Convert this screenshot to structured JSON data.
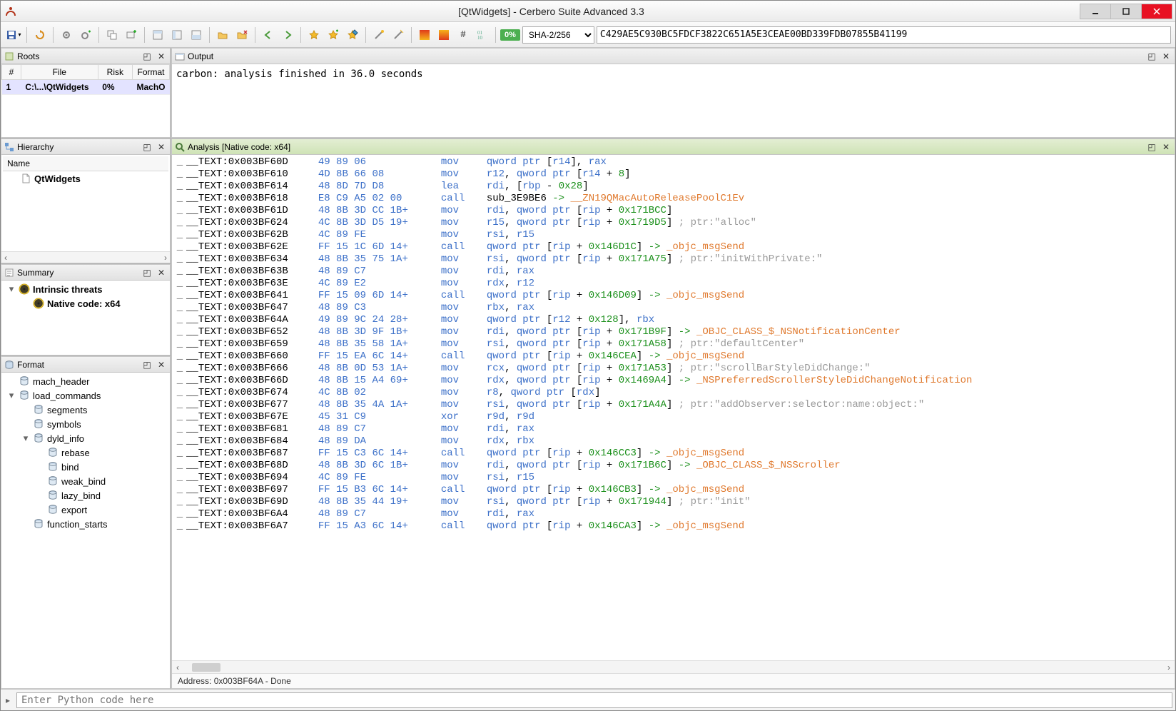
{
  "window": {
    "title": "[QtWidgets] - Cerbero Suite Advanced 3.3"
  },
  "toolbar": {
    "pct": "0%",
    "hash_algo": "SHA-2/256",
    "hash_value": "C429AE5C930BC5FDCF3822C651A5E3CEAE00BD339FDB07855B41199"
  },
  "roots": {
    "title": "Roots",
    "cols": [
      "#",
      "File",
      "Risk",
      "Format"
    ],
    "rows": [
      {
        "n": "1",
        "file": "C:\\...\\QtWidgets",
        "risk": "0%",
        "format": "MachO"
      }
    ]
  },
  "output": {
    "title": "Output",
    "text": "carbon: analysis finished in 36.0 seconds"
  },
  "hierarchy": {
    "title": "Hierarchy",
    "header": "Name",
    "items": [
      {
        "label": "QtWidgets",
        "icon": "file"
      }
    ]
  },
  "summary": {
    "title": "Summary",
    "items": [
      {
        "label": "Intrinsic threats",
        "icon": "nuke",
        "expand": true,
        "bold": true,
        "indent": 0
      },
      {
        "label": "Native code: x64",
        "icon": "nuke",
        "bold": true,
        "indent": 1
      }
    ]
  },
  "format": {
    "title": "Format",
    "items": [
      {
        "label": "mach_header",
        "icon": "db",
        "indent": 0
      },
      {
        "label": "load_commands",
        "icon": "db",
        "indent": 0,
        "expand": true
      },
      {
        "label": "segments",
        "icon": "db",
        "indent": 1
      },
      {
        "label": "symbols",
        "icon": "db",
        "indent": 1
      },
      {
        "label": "dyld_info",
        "icon": "db",
        "indent": 1,
        "expand": true
      },
      {
        "label": "rebase",
        "icon": "db",
        "indent": 2
      },
      {
        "label": "bind",
        "icon": "db",
        "indent": 2
      },
      {
        "label": "weak_bind",
        "icon": "db",
        "indent": 2
      },
      {
        "label": "lazy_bind",
        "icon": "db",
        "indent": 2
      },
      {
        "label": "export",
        "icon": "db",
        "indent": 2
      },
      {
        "label": "function_starts",
        "icon": "db",
        "indent": 1
      }
    ]
  },
  "analysis": {
    "title": "Analysis [Native code: x64]",
    "status": "Address: 0x003BF64A - Done",
    "lines": [
      {
        "a": "__TEXT:0x003BF60D",
        "h": "49 89 06",
        "m": "mov",
        "ops": [
          [
            "kw",
            "qword ptr "
          ],
          [
            "txt",
            "["
          ],
          [
            "reg",
            "r14"
          ],
          [
            "txt",
            "], "
          ],
          [
            "reg",
            "rax"
          ]
        ]
      },
      {
        "a": "__TEXT:0x003BF610",
        "h": "4D 8B 66 08",
        "m": "mov",
        "ops": [
          [
            "reg",
            "r12"
          ],
          [
            "txt",
            ", "
          ],
          [
            "kw",
            "qword ptr "
          ],
          [
            "txt",
            "["
          ],
          [
            "reg",
            "r14"
          ],
          [
            "txt",
            " + "
          ],
          [
            "num",
            "8"
          ],
          [
            "txt",
            "]"
          ]
        ]
      },
      {
        "a": "__TEXT:0x003BF614",
        "h": "48 8D 7D D8",
        "m": "lea",
        "ops": [
          [
            "reg",
            "rdi"
          ],
          [
            "txt",
            ", ["
          ],
          [
            "reg",
            "rbp"
          ],
          [
            "txt",
            " - "
          ],
          [
            "num",
            "0x28"
          ],
          [
            "txt",
            "]"
          ]
        ]
      },
      {
        "a": "__TEXT:0x003BF618",
        "h": "E8 C9 A5 02 00",
        "m": "call",
        "ops": [
          [
            "txt",
            "sub_3E9BE6 "
          ],
          [
            "arrow",
            "-> "
          ],
          [
            "sym",
            "__ZN19QMacAutoReleasePoolC1Ev"
          ]
        ]
      },
      {
        "a": "__TEXT:0x003BF61D",
        "h": "48 8B 3D CC 1B+",
        "m": "mov",
        "ops": [
          [
            "reg",
            "rdi"
          ],
          [
            "txt",
            ", "
          ],
          [
            "kw",
            "qword ptr "
          ],
          [
            "txt",
            "["
          ],
          [
            "reg",
            "rip"
          ],
          [
            "txt",
            " + "
          ],
          [
            "num",
            "0x171BCC"
          ],
          [
            "txt",
            "]"
          ]
        ]
      },
      {
        "a": "__TEXT:0x003BF624",
        "h": "4C 8B 3D D5 19+",
        "m": "mov",
        "ops": [
          [
            "reg",
            "r15"
          ],
          [
            "txt",
            ", "
          ],
          [
            "kw",
            "qword ptr "
          ],
          [
            "txt",
            "["
          ],
          [
            "reg",
            "rip"
          ],
          [
            "txt",
            " + "
          ],
          [
            "num",
            "0x1719D5"
          ],
          [
            "txt",
            "] "
          ],
          [
            "cmt",
            "; ptr:\"alloc\""
          ]
        ]
      },
      {
        "a": "__TEXT:0x003BF62B",
        "h": "4C 89 FE",
        "m": "mov",
        "ops": [
          [
            "reg",
            "rsi"
          ],
          [
            "txt",
            ", "
          ],
          [
            "reg",
            "r15"
          ]
        ]
      },
      {
        "a": "__TEXT:0x003BF62E",
        "h": "FF 15 1C 6D 14+",
        "m": "call",
        "ops": [
          [
            "kw",
            "qword ptr "
          ],
          [
            "txt",
            "["
          ],
          [
            "reg",
            "rip"
          ],
          [
            "txt",
            " + "
          ],
          [
            "num",
            "0x146D1C"
          ],
          [
            "txt",
            "] "
          ],
          [
            "arrow",
            "-> "
          ],
          [
            "sym",
            "_objc_msgSend"
          ]
        ]
      },
      {
        "a": "__TEXT:0x003BF634",
        "h": "48 8B 35 75 1A+",
        "m": "mov",
        "ops": [
          [
            "reg",
            "rsi"
          ],
          [
            "txt",
            ", "
          ],
          [
            "kw",
            "qword ptr "
          ],
          [
            "txt",
            "["
          ],
          [
            "reg",
            "rip"
          ],
          [
            "txt",
            " + "
          ],
          [
            "num",
            "0x171A75"
          ],
          [
            "txt",
            "] "
          ],
          [
            "cmt",
            "; ptr:\"initWithPrivate:\""
          ]
        ]
      },
      {
        "a": "__TEXT:0x003BF63B",
        "h": "48 89 C7",
        "m": "mov",
        "ops": [
          [
            "reg",
            "rdi"
          ],
          [
            "txt",
            ", "
          ],
          [
            "reg",
            "rax"
          ]
        ]
      },
      {
        "a": "__TEXT:0x003BF63E",
        "h": "4C 89 E2",
        "m": "mov",
        "ops": [
          [
            "reg",
            "rdx"
          ],
          [
            "txt",
            ", "
          ],
          [
            "reg",
            "r12"
          ]
        ]
      },
      {
        "a": "__TEXT:0x003BF641",
        "h": "FF 15 09 6D 14+",
        "m": "call",
        "ops": [
          [
            "kw",
            "qword ptr "
          ],
          [
            "txt",
            "["
          ],
          [
            "reg",
            "rip"
          ],
          [
            "txt",
            " + "
          ],
          [
            "num",
            "0x146D09"
          ],
          [
            "txt",
            "] "
          ],
          [
            "arrow",
            "-> "
          ],
          [
            "sym",
            "_objc_msgSend"
          ]
        ]
      },
      {
        "a": "__TEXT:0x003BF647",
        "h": "48 89 C3",
        "m": "mov",
        "ops": [
          [
            "reg",
            "rbx"
          ],
          [
            "txt",
            ", "
          ],
          [
            "reg",
            "rax"
          ]
        ]
      },
      {
        "a": "__TEXT:0x003BF64A",
        "h": "49 89 9C 24 28+",
        "m": "mov",
        "ops": [
          [
            "kw",
            "qword ptr "
          ],
          [
            "txt",
            "["
          ],
          [
            "reg",
            "r12"
          ],
          [
            "txt",
            " + "
          ],
          [
            "num",
            "0x128"
          ],
          [
            "txt",
            "], "
          ],
          [
            "reg",
            "rbx"
          ]
        ]
      },
      {
        "a": "__TEXT:0x003BF652",
        "h": "48 8B 3D 9F 1B+",
        "m": "mov",
        "ops": [
          [
            "reg",
            "rdi"
          ],
          [
            "txt",
            ", "
          ],
          [
            "kw",
            "qword ptr "
          ],
          [
            "txt",
            "["
          ],
          [
            "reg",
            "rip"
          ],
          [
            "txt",
            " + "
          ],
          [
            "num",
            "0x171B9F"
          ],
          [
            "txt",
            "] "
          ],
          [
            "arrow",
            "-> "
          ],
          [
            "sym",
            "_OBJC_CLASS_$_NSNotificationCenter"
          ]
        ]
      },
      {
        "a": "__TEXT:0x003BF659",
        "h": "48 8B 35 58 1A+",
        "m": "mov",
        "ops": [
          [
            "reg",
            "rsi"
          ],
          [
            "txt",
            ", "
          ],
          [
            "kw",
            "qword ptr "
          ],
          [
            "txt",
            "["
          ],
          [
            "reg",
            "rip"
          ],
          [
            "txt",
            " + "
          ],
          [
            "num",
            "0x171A58"
          ],
          [
            "txt",
            "] "
          ],
          [
            "cmt",
            "; ptr:\"defaultCenter\""
          ]
        ]
      },
      {
        "a": "__TEXT:0x003BF660",
        "h": "FF 15 EA 6C 14+",
        "m": "call",
        "ops": [
          [
            "kw",
            "qword ptr "
          ],
          [
            "txt",
            "["
          ],
          [
            "reg",
            "rip"
          ],
          [
            "txt",
            " + "
          ],
          [
            "num",
            "0x146CEA"
          ],
          [
            "txt",
            "] "
          ],
          [
            "arrow",
            "-> "
          ],
          [
            "sym",
            "_objc_msgSend"
          ]
        ]
      },
      {
        "a": "__TEXT:0x003BF666",
        "h": "48 8B 0D 53 1A+",
        "m": "mov",
        "ops": [
          [
            "reg",
            "rcx"
          ],
          [
            "txt",
            ", "
          ],
          [
            "kw",
            "qword ptr "
          ],
          [
            "txt",
            "["
          ],
          [
            "reg",
            "rip"
          ],
          [
            "txt",
            " + "
          ],
          [
            "num",
            "0x171A53"
          ],
          [
            "txt",
            "] "
          ],
          [
            "cmt",
            "; ptr:\"scrollBarStyleDidChange:\""
          ]
        ]
      },
      {
        "a": "__TEXT:0x003BF66D",
        "h": "48 8B 15 A4 69+",
        "m": "mov",
        "ops": [
          [
            "reg",
            "rdx"
          ],
          [
            "txt",
            ", "
          ],
          [
            "kw",
            "qword ptr "
          ],
          [
            "txt",
            "["
          ],
          [
            "reg",
            "rip"
          ],
          [
            "txt",
            " + "
          ],
          [
            "num",
            "0x1469A4"
          ],
          [
            "txt",
            "] "
          ],
          [
            "arrow",
            "-> "
          ],
          [
            "sym",
            "_NSPreferredScrollerStyleDidChangeNotification"
          ]
        ]
      },
      {
        "a": "__TEXT:0x003BF674",
        "h": "4C 8B 02",
        "m": "mov",
        "ops": [
          [
            "reg",
            "r8"
          ],
          [
            "txt",
            ", "
          ],
          [
            "kw",
            "qword ptr "
          ],
          [
            "txt",
            "["
          ],
          [
            "reg",
            "rdx"
          ],
          [
            "txt",
            "]"
          ]
        ]
      },
      {
        "a": "__TEXT:0x003BF677",
        "h": "48 8B 35 4A 1A+",
        "m": "mov",
        "ops": [
          [
            "reg",
            "rsi"
          ],
          [
            "txt",
            ", "
          ],
          [
            "kw",
            "qword ptr "
          ],
          [
            "txt",
            "["
          ],
          [
            "reg",
            "rip"
          ],
          [
            "txt",
            " + "
          ],
          [
            "num",
            "0x171A4A"
          ],
          [
            "txt",
            "] "
          ],
          [
            "cmt",
            "; ptr:\"addObserver:selector:name:object:\""
          ]
        ]
      },
      {
        "a": "__TEXT:0x003BF67E",
        "h": "45 31 C9",
        "m": "xor",
        "ops": [
          [
            "reg",
            "r9d"
          ],
          [
            "txt",
            ", "
          ],
          [
            "reg",
            "r9d"
          ]
        ]
      },
      {
        "a": "__TEXT:0x003BF681",
        "h": "48 89 C7",
        "m": "mov",
        "ops": [
          [
            "reg",
            "rdi"
          ],
          [
            "txt",
            ", "
          ],
          [
            "reg",
            "rax"
          ]
        ]
      },
      {
        "a": "__TEXT:0x003BF684",
        "h": "48 89 DA",
        "m": "mov",
        "ops": [
          [
            "reg",
            "rdx"
          ],
          [
            "txt",
            ", "
          ],
          [
            "reg",
            "rbx"
          ]
        ]
      },
      {
        "a": "__TEXT:0x003BF687",
        "h": "FF 15 C3 6C 14+",
        "m": "call",
        "ops": [
          [
            "kw",
            "qword ptr "
          ],
          [
            "txt",
            "["
          ],
          [
            "reg",
            "rip"
          ],
          [
            "txt",
            " + "
          ],
          [
            "num",
            "0x146CC3"
          ],
          [
            "txt",
            "] "
          ],
          [
            "arrow",
            "-> "
          ],
          [
            "sym",
            "_objc_msgSend"
          ]
        ]
      },
      {
        "a": "__TEXT:0x003BF68D",
        "h": "48 8B 3D 6C 1B+",
        "m": "mov",
        "ops": [
          [
            "reg",
            "rdi"
          ],
          [
            "txt",
            ", "
          ],
          [
            "kw",
            "qword ptr "
          ],
          [
            "txt",
            "["
          ],
          [
            "reg",
            "rip"
          ],
          [
            "txt",
            " + "
          ],
          [
            "num",
            "0x171B6C"
          ],
          [
            "txt",
            "] "
          ],
          [
            "arrow",
            "-> "
          ],
          [
            "sym",
            "_OBJC_CLASS_$_NSScroller"
          ]
        ]
      },
      {
        "a": "__TEXT:0x003BF694",
        "h": "4C 89 FE",
        "m": "mov",
        "ops": [
          [
            "reg",
            "rsi"
          ],
          [
            "txt",
            ", "
          ],
          [
            "reg",
            "r15"
          ]
        ]
      },
      {
        "a": "__TEXT:0x003BF697",
        "h": "FF 15 B3 6C 14+",
        "m": "call",
        "ops": [
          [
            "kw",
            "qword ptr "
          ],
          [
            "txt",
            "["
          ],
          [
            "reg",
            "rip"
          ],
          [
            "txt",
            " + "
          ],
          [
            "num",
            "0x146CB3"
          ],
          [
            "txt",
            "] "
          ],
          [
            "arrow",
            "-> "
          ],
          [
            "sym",
            "_objc_msgSend"
          ]
        ]
      },
      {
        "a": "__TEXT:0x003BF69D",
        "h": "48 8B 35 44 19+",
        "m": "mov",
        "ops": [
          [
            "reg",
            "rsi"
          ],
          [
            "txt",
            ", "
          ],
          [
            "kw",
            "qword ptr "
          ],
          [
            "txt",
            "["
          ],
          [
            "reg",
            "rip"
          ],
          [
            "txt",
            " + "
          ],
          [
            "num",
            "0x171944"
          ],
          [
            "txt",
            "] "
          ],
          [
            "cmt",
            "; ptr:\"init\""
          ]
        ]
      },
      {
        "a": "__TEXT:0x003BF6A4",
        "h": "48 89 C7",
        "m": "mov",
        "ops": [
          [
            "reg",
            "rdi"
          ],
          [
            "txt",
            ", "
          ],
          [
            "reg",
            "rax"
          ]
        ]
      },
      {
        "a": "__TEXT:0x003BF6A7",
        "h": "FF 15 A3 6C 14+",
        "m": "call",
        "ops": [
          [
            "kw",
            "qword ptr "
          ],
          [
            "txt",
            "["
          ],
          [
            "reg",
            "rip"
          ],
          [
            "txt",
            " + "
          ],
          [
            "num",
            "0x146CA3"
          ],
          [
            "txt",
            "] "
          ],
          [
            "arrow",
            "-> "
          ],
          [
            "sym",
            "_objc_msgSend"
          ]
        ]
      }
    ]
  },
  "console": {
    "placeholder": "Enter Python code here"
  }
}
